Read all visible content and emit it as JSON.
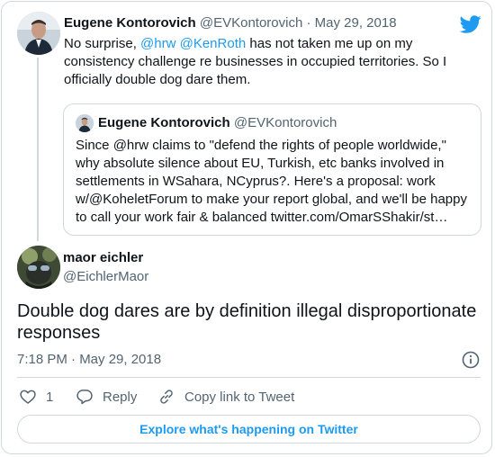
{
  "parent_tweet": {
    "author_name": "Eugene Kontorovich",
    "author_handle": "@EVKontorovich",
    "separator": "·",
    "date": "May 29, 2018",
    "text_prefix": "No surprise, ",
    "mention_1": "@hrw",
    "mention_2": "@KenRoth",
    "text_suffix": " has not taken me up on my consistency challenge re businesses in occupied territories. So I officially double dog dare them."
  },
  "quoted_tweet": {
    "author_name": "Eugene Kontorovich",
    "author_handle": "@EVKontorovich",
    "text": "Since @hrw claims to \"defend the rights of people worldwide,\" why absolute silence about EU, Turkish, etc banks involved in settlements in WSahara, NCyprus?. Here's a proposal: work w/@KoheletForum to make your report global, and we'll be happy to call your work fair & balanced twitter.com/OmarSShakir/st…"
  },
  "main_tweet": {
    "author_name": "maor eichler",
    "author_handle": "@EichlerMaor",
    "text": "Double dog dares are by definition illegal disproportionate responses",
    "timestamp": "7:18 PM · May 29, 2018"
  },
  "actions": {
    "like_count": "1",
    "reply_label": "Reply",
    "copy_link_label": "Copy link to Tweet"
  },
  "explore_label": "Explore what's happening on Twitter",
  "icons": {
    "brand": "twitter-bird-icon",
    "info": "info-icon",
    "like": "heart-icon",
    "reply": "reply-icon",
    "copy_link": "link-icon"
  },
  "colors": {
    "accent": "#1d9bf0",
    "muted_text": "#536471",
    "border": "#cfd9de",
    "text": "#0f1419"
  }
}
